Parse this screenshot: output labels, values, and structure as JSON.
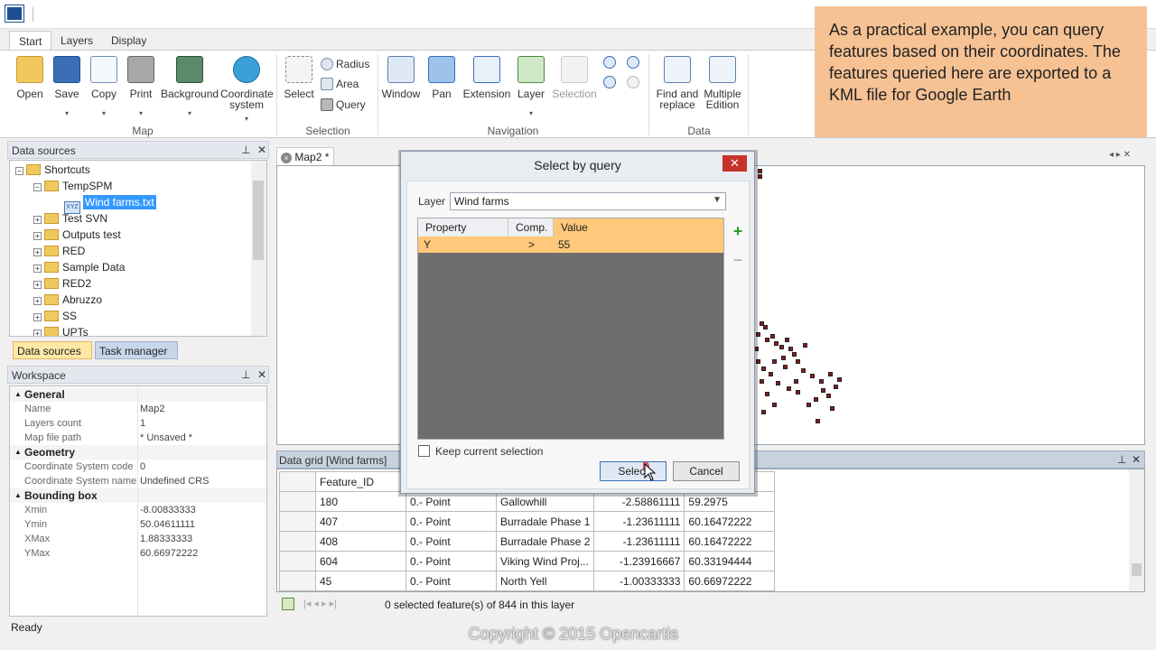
{
  "ribbon": {
    "tabs": [
      "Start",
      "Layers",
      "Display"
    ],
    "map_group": {
      "label": "Map",
      "buttons": [
        "Open",
        "Save",
        "Copy",
        "Print",
        "Background",
        "Coordinate system"
      ]
    },
    "selection_group": {
      "label": "Selection",
      "select": "Select",
      "radius": "Radius",
      "area": "Area",
      "query": "Query"
    },
    "navigation_group": {
      "label": "Navigation",
      "buttons": [
        "Window",
        "Pan",
        "Extension",
        "Layer",
        "Selection"
      ]
    },
    "data_group": {
      "label": "Data",
      "find_replace": "Find and replace",
      "multiple_edition": "Multiple Edition"
    }
  },
  "data_sources": {
    "title": "Data sources",
    "tree": [
      "Shortcuts",
      "TempSPM",
      "Wind farms.txt",
      "Test SVN",
      "Outputs test",
      "RED",
      "Sample Data",
      "RED2",
      "Abruzzo",
      "SS",
      "UPTs"
    ],
    "tab_data_sources": "Data sources",
    "tab_task_manager": "Task manager"
  },
  "workspace": {
    "title": "Workspace",
    "general": "General",
    "name_k": "Name",
    "name_v": "Map2",
    "layers_k": "Layers count",
    "layers_v": "1",
    "path_k": "Map file path",
    "path_v": "* Unsaved *",
    "geometry": "Geometry",
    "csc_k": "Coordinate System code",
    "csc_v": "0",
    "csn_k": "Coordinate System name",
    "csn_v": "Undefined CRS",
    "bbox": "Bounding box",
    "xmin_k": "Xmin",
    "xmin_v": "-8.00833333",
    "ymin_k": "Ymin",
    "ymin_v": "50.04611111",
    "xmax_k": "XMax",
    "xmax_v": "1.88333333",
    "ymax_k": "YMax",
    "ymax_v": "60.66972222"
  },
  "status": "Ready",
  "map": {
    "tab": "Map2 *"
  },
  "datagrid": {
    "title": "Data grid [Wind farms]",
    "col_feature": "Feature_ID",
    "rows": [
      [
        "180",
        "0.- Point",
        "Gallowhill",
        "-2.58861111",
        "59.2975"
      ],
      [
        "407",
        "0.- Point",
        "Burradale Phase 1",
        "-1.23611111",
        "60.16472222"
      ],
      [
        "408",
        "0.- Point",
        "Burradale Phase 2",
        "-1.23611111",
        "60.16472222"
      ],
      [
        "604",
        "0.- Point",
        "Viking Wind Proj...",
        "-1.23916667",
        "60.33194444"
      ],
      [
        "45",
        "0.- Point",
        "North Yell",
        "-1.00333333",
        "60.66972222"
      ]
    ],
    "footer": "0 selected feature(s) of 844 in this layer"
  },
  "dialog": {
    "title": "Select by query",
    "layer_label": "Layer",
    "layer_value": "Wind farms",
    "col_property": "Property",
    "col_comp": "Comp.",
    "col_value": "Value",
    "row_property": "Y",
    "row_comp": ">",
    "row_value": "55",
    "keep_selection": "Keep current selection",
    "select_btn": "Select",
    "cancel_btn": "Cancel"
  },
  "note": "As a practical example, you can query features based on their coordinates. The features queried here are exported to a KML file for Google Earth",
  "copyright": "Copyright © 2015 Opencartis",
  "colors": {
    "accent": "#3399ff",
    "query_row": "#ffc87a",
    "note_bg": "#f6c294",
    "close_red": "#c7332a"
  }
}
